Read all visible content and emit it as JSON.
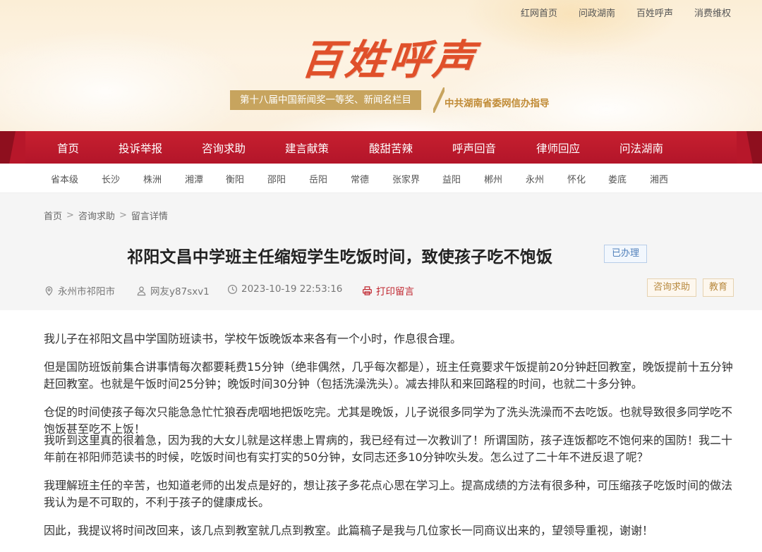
{
  "top_links": [
    "红网首页",
    "问政湖南",
    "百姓呼声",
    "消费维权"
  ],
  "logo_text": "百姓呼声",
  "award_badge": "第十八届中国新闻奖一等奖、新闻名栏目",
  "guide_text": "中共湖南省委网信办指导",
  "main_nav": [
    "首页",
    "投诉举报",
    "咨询求助",
    "建言献策",
    "酸甜苦辣",
    "呼声回音",
    "律师回应",
    "问法湖南"
  ],
  "city_nav": [
    "省本级",
    "长沙",
    "株洲",
    "湘潭",
    "衡阳",
    "邵阳",
    "岳阳",
    "常德",
    "张家界",
    "益阳",
    "郴州",
    "永州",
    "怀化",
    "娄底",
    "湘西"
  ],
  "breadcrumb": [
    "首页",
    "咨询求助",
    "留言详情"
  ],
  "breadcrumb_sep": ">",
  "post": {
    "title": "祁阳文昌中学班主任缩短学生吃饭时间，致使孩子吃不饱饭",
    "status": "已办理",
    "location": "永州市祁阳市",
    "author": "网友y87sxv1",
    "datetime": "2023-10-19 22:53:16",
    "print_label": "打印留言",
    "tags": [
      "咨询求助",
      "教育"
    ],
    "paragraphs": [
      "我儿子在祁阳文昌中学国防班读书，学校午饭晚饭本来各有一个小时，作息很合理。",
      "但是国防班饭前集合讲事情每次都要耗费15分钟（绝非偶然，几乎每次都是），班主任竟要求午饭提前20分钟赶回教室，晚饭提前十五分钟赶回教室。也就是午饭时间25分钟；晚饭时间30分钟（包括洗澡洗头）。减去排队和来回路程的时间，也就二十多分钟。",
      "仓促的时间使孩子每次只能急急忙忙狼吞虎咽地把饭吃完。尤其是晚饭，儿子说很多同学为了洗头洗澡而不去吃饭。也就导致很多同学吃不饱饭甚至吃不上饭！",
      "我听到这里真的很着急，因为我的大女儿就是这样患上胃病的，我已经有过一次教训了！所谓国防，孩子连饭都吃不饱何来的国防！我二十年前在祁阳师范读书的时候，吃饭时间也有实打实的50分钟，女同志还多10分钟吹头发。怎么过了二十年不进反退了呢？",
      "我理解班主任的辛苦，也知道老师的出发点是好的，想让孩子多花点心思在学习上。提高成绩的方法有很多种，可压缩孩子吃饭时间的做法我认为是不可取的，不利于孩子的健康成长。",
      "因此，我提议将时间改回来，该几点到教室就几点到教室。此篇稿子是我与几位家长一同商议出来的，望领导重视，谢谢！"
    ]
  },
  "colors": {
    "nav_red": "#b7172a",
    "logo_orange": "#e0502a",
    "award_gold": "#c7a45e",
    "print_red": "#c0262f",
    "status_blue": "#4f7fba"
  }
}
